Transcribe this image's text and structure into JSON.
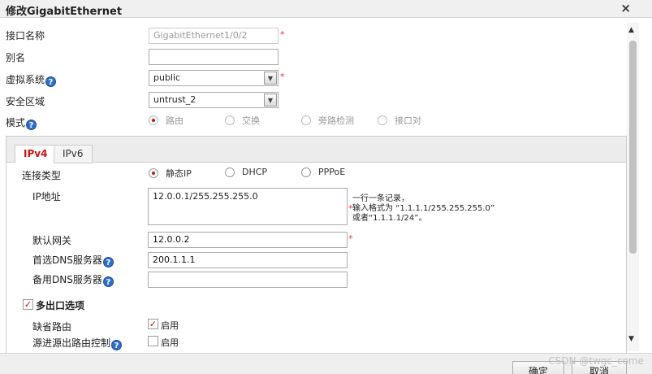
{
  "dialog": {
    "title": "修改GigabitEthernet",
    "close": "×"
  },
  "form": {
    "interface_name": {
      "label": "接口名称",
      "value": "GigabitEthernet1/0/2"
    },
    "alias": {
      "label": "别名",
      "value": ""
    },
    "vsys": {
      "label": "虚拟系统",
      "value": "public"
    },
    "zone": {
      "label": "安全区域",
      "value": "untrust_2"
    },
    "mode": {
      "label": "模式",
      "options": [
        "路由",
        "交换",
        "旁路检测",
        "接口对"
      ],
      "selected": "路由"
    },
    "required_mark": "*",
    "help_glyph": "?"
  },
  "tabs": [
    {
      "label": "IPv4"
    },
    {
      "label": "IPv6"
    }
  ],
  "ipv4": {
    "conn_type": {
      "label": "连接类型",
      "options": [
        "静态IP",
        "DHCP",
        "PPPoE"
      ],
      "selected": "静态IP"
    },
    "ip_address": {
      "label": "IP地址",
      "value": "12.0.0.1/255.255.255.0",
      "hint": [
        "一行一条记录，",
        "输入格式为 “1.1.1.1/255.255.255.0”",
        "或者“1.1.1.1/24”。"
      ]
    },
    "gateway": {
      "label": "默认网关",
      "value": "12.0.0.2"
    },
    "dns_primary": {
      "label": "首选DNS服务器",
      "value": "200.1.1.1"
    },
    "dns_secondary": {
      "label": "备用DNS服务器",
      "value": ""
    }
  },
  "multi_exit": {
    "title": "多出口选项",
    "checked": true,
    "default_route": {
      "label": "缺省路由",
      "check_label": "启用",
      "checked": true
    },
    "source_route": {
      "label": "源进源出路由控制",
      "check_label": "启用",
      "checked": false
    }
  },
  "footer": {
    "ok": "确定",
    "cancel": "取消",
    "watermark": "CSDN @twgc_come"
  },
  "icons": {
    "check": "✓",
    "scroll_up": "▲",
    "scroll_down": "▼",
    "dropdown": "▼"
  }
}
